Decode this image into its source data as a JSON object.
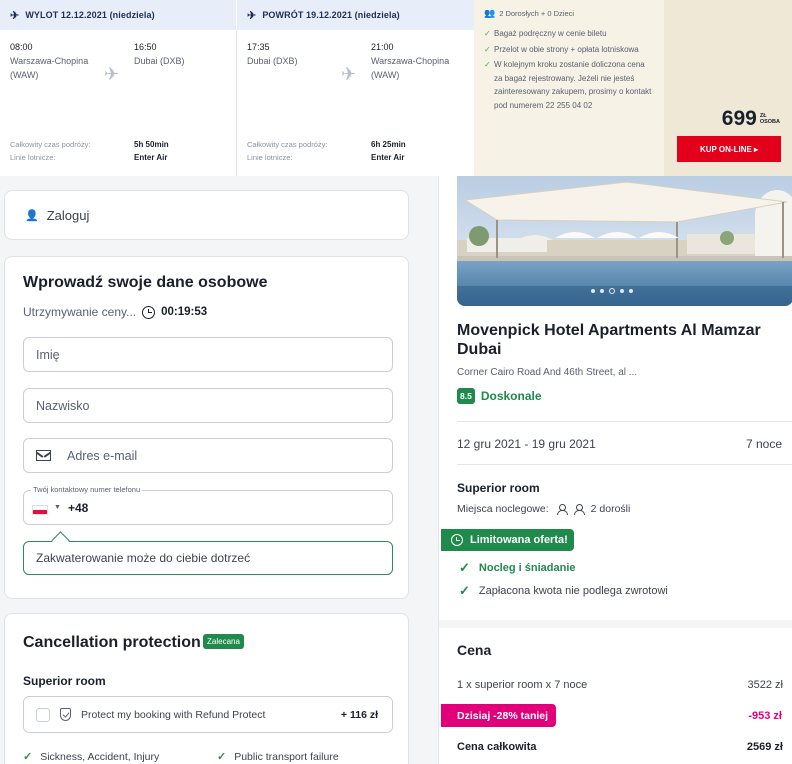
{
  "outbound": {
    "header": "WYLOT 12.12.2021 (niedziela)",
    "dep_time": "08:00",
    "dep_place": "Warszawa-Chopina (WAW)",
    "arr_time": "16:50",
    "arr_place": "Dubai (DXB)",
    "duration_label": "Całkowity czas podróży:",
    "duration": "5h 50min",
    "airline_label": "Linie lotnicze:",
    "airline": "Enter Air"
  },
  "return": {
    "header": "POWRÓT 19.12.2021 (niedziela)",
    "dep_time": "17:35",
    "dep_place": "Dubai (DXB)",
    "arr_time": "21:00",
    "arr_place": "Warszawa-Chopina (WAW)",
    "duration_label": "Całkowity czas podróży:",
    "duration": "6h 25min",
    "airline_label": "Linie lotnicze:",
    "airline": "Enter Air"
  },
  "offer": {
    "passengers": "2 Dorosłych + 0 Dzieci",
    "features": [
      "Bagaż podręczny w cenie biletu",
      "Przelot w obie strony + opłata lotniskowa",
      "W kolejnym kroku zostanie doliczona cena za bagaż rejestrowany. Jeżeli nie jesteś zainteresowany zakupem, prosimy o kontakt pod numerem 22 255 04 02"
    ],
    "price": "699",
    "currency": "ZŁ",
    "per": "OSOBA",
    "buy_label": "KUP ON-LINE ▸"
  },
  "login": {
    "label": "Zaloguj"
  },
  "personal": {
    "title": "Wprowadź swoje dane osobowe",
    "hold_label": "Utrzymywanie ceny...",
    "timer": "00:19:53",
    "first_name_placeholder": "Imię",
    "last_name_placeholder": "Nazwisko",
    "email_placeholder": "Adres e-mail",
    "phone_legend": "Twój kontaktowy numer telefonu",
    "dial_code": "+48",
    "notice": "Zakwaterowanie może do ciebie dotrzeć"
  },
  "cancellation": {
    "title": "Cancellation protection",
    "badge": "Zalecana",
    "room": "Superior room",
    "protect_label": "Protect my booking with Refund Protect",
    "protect_price": "+ 116 zł",
    "covers": [
      "Sickness, Accident, Injury",
      "Public transport failure"
    ]
  },
  "hotel": {
    "name": "Movenpick Hotel Apartments Al Mamzar Dubai",
    "address": "Corner Cairo Road And 46th Street, al ...",
    "score": "8.5",
    "rating_word": "Doskonale",
    "dates": "12 gru 2021 - 19 gru 2021",
    "nights": "7 noce",
    "room": "Superior room",
    "beds_label": "Miejsca noclegowe:",
    "beds_value": "2 dorośli",
    "limited": "Limitowana oferta!",
    "perks": [
      "Nocleg i śniadanie",
      "Zapłacona kwota nie podlega zwrotowi"
    ]
  },
  "pricing": {
    "title": "Cena",
    "line_label": "1 x superior room  x 7 noce",
    "line_value": "3522 zł",
    "discount_label": "Dzisiaj -28% taniej",
    "discount_value": "-953 zł",
    "total_label": "Cena całkowita",
    "total_value": "2569 zł"
  },
  "colors": {
    "accent_green": "#1f8a4c",
    "buy_red": "#e2001a",
    "discount_pink": "#e2007a"
  }
}
